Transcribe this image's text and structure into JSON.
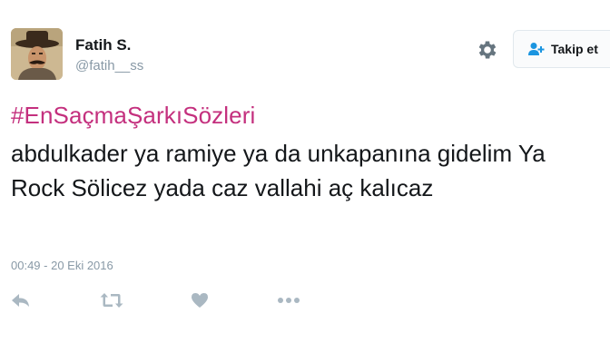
{
  "user": {
    "display_name": "Fatih S.",
    "username": "@fatih__ss",
    "avatar_icon": "avatar-photo"
  },
  "header": {
    "settings_icon": "gear-icon",
    "follow_button": {
      "label": "Takip et",
      "icon": "add-user-icon"
    }
  },
  "tweet": {
    "hashtag": "#EnSaçmaŞarkıSözleri",
    "text": "abdulkader ya ramiye ya da unkapanına gidelim Ya Rock Sölicez yada caz vallahi aç kalıcaz",
    "timestamp": "00:49 - 20 Eki 2016"
  },
  "actions": {
    "icons": [
      "reply-icon",
      "retweet-icon",
      "like-icon",
      "more-icon"
    ]
  },
  "colors": {
    "hashtag": "#c4307e",
    "text": "#14171a",
    "secondary": "#8899a6",
    "icon_gray": "#aab8c2"
  }
}
